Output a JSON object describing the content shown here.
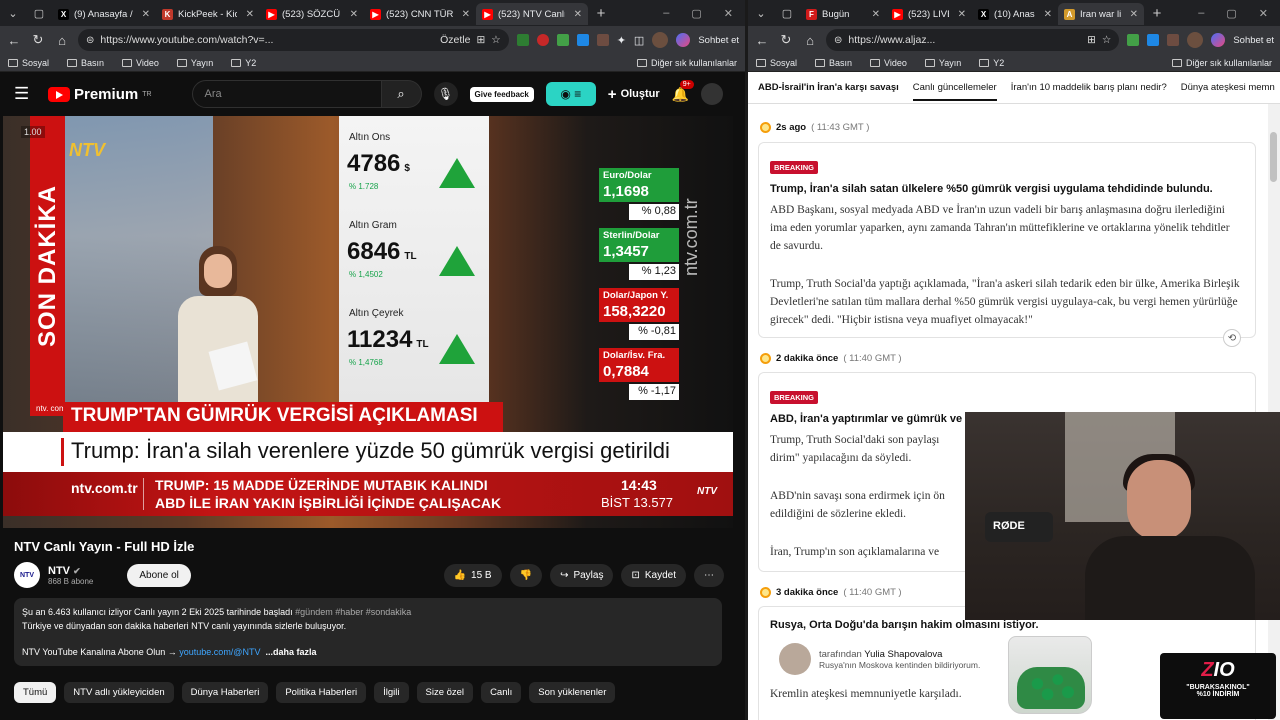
{
  "left_browser": {
    "tabs": [
      {
        "title": "(9) Anasayfa / X",
        "fav_color": "#000000",
        "fav_glyph": "X"
      },
      {
        "title": "KickPeek - Kick.com",
        "fav_color": "#53fc18",
        "fav_glyph": "K"
      },
      {
        "title": "(523) SÖZCÜ TV Can",
        "fav_color": "#ff0000",
        "fav_glyph": "▶"
      },
      {
        "title": "(523) CNN TÜRK",
        "fav_color": "#ff0000",
        "fav_glyph": "▶"
      },
      {
        "title": "(523) NTV Canlı",
        "fav_color": "#ff0000",
        "fav_glyph": "▶"
      }
    ],
    "url": "https://www.youtube.com/watch?v=...",
    "ozetle": "Özetle",
    "bookmarks": [
      "Sosyal",
      "Basın",
      "Video",
      "Yayın",
      "Y2"
    ],
    "bookmark_other": "Diğer sık kullanılanlar",
    "chat_label": "Sohbet et"
  },
  "youtube": {
    "brand": "Premium",
    "brand_sup": "TR",
    "search_placeholder": "Ara",
    "feedback": "Give feedback",
    "create": "Oluştur",
    "notif_count": "9+",
    "video_title": "NTV Canlı Yayın - Full HD İzle",
    "channel_name": "NTV",
    "channel_subs": "868 B abone",
    "subscribe": "Abone ol",
    "likes": "15 B",
    "share": "Paylaş",
    "save": "Kaydet",
    "desc_line1_a": "Şu an 6.463 kullanıcı izliyor  Canlı yayın 2 Eki 2025 tarihinde başladı  ",
    "desc_line1_tags": "#gündem #haber #sondakika",
    "desc_line2": "Türkiye ve dünyadan son dakika haberleri NTV canlı yayınında sizlerle buluşuyor.",
    "desc_line3_a": "NTV YouTube Kanalına Abone Olun → ",
    "desc_line3_link": "youtube.com/@NTV",
    "desc_more": "...daha fazla",
    "chips": [
      "Tümü",
      "NTV adlı yükleyiciden",
      "Dünya Haberleri",
      "Politika Haberleri",
      "İlgili",
      "Size özel",
      "Canlı",
      "Son yüklenenler"
    ]
  },
  "broadcast": {
    "speed": "1.00",
    "son_dakika": "SON DAKİKA",
    "ntv_logo": "NTV",
    "ntv_small": "ntv. com. tr",
    "gold": [
      {
        "name": "Altın Ons",
        "value": "4786",
        "unit": "$",
        "pct": "% 1.728"
      },
      {
        "name": "Altın Gram",
        "value": "6846",
        "unit": "TL",
        "pct": "% 1,4502"
      },
      {
        "name": "Altın Çeyrek",
        "value": "11234",
        "unit": "TL",
        "pct": "% 1,4768"
      }
    ],
    "fx": [
      {
        "name": "Euro/Dolar",
        "value": "1,1698",
        "pct": "% 0,88",
        "color": "#1f9d3a"
      },
      {
        "name": "Sterlin/Dolar",
        "value": "1,3457",
        "pct": "% 1,23",
        "color": "#1f9d3a"
      },
      {
        "name": "Dolar/Japon Y.",
        "value": "158,3220",
        "pct": "% -0,81",
        "color": "#cc1111"
      },
      {
        "name": "Dolar/İsv. Fra.",
        "value": "0,7884",
        "pct": "% -1,17",
        "color": "#cc1111"
      }
    ],
    "vertical_site": "ntv.com.tr",
    "headline_red": "TRUMP'TAN GÜMRÜK VERGİSİ AÇIKLAMASI",
    "headline_white": "Trump: İran'a silah verenlere yüzde 50 gümrük vergisi getirildi",
    "ticker_site": "ntv.com.tr",
    "ticker_line1": "TRUMP: 15 MADDE ÜZERİNDE MUTABIK KALINDI",
    "ticker_line2": "ABD İLE İRAN YAKIN İŞBİRLİĞİ İÇİNDE ÇALIŞACAK",
    "time": "14:43",
    "bist": "BİST  13.577",
    "ticker_ntv": "NTV"
  },
  "right_browser": {
    "tabs": [
      {
        "title": "Bugün",
        "fav_color": "#d11a1a",
        "fav_glyph": "F"
      },
      {
        "title": "(523) LIVE: V",
        "fav_color": "#ff0000",
        "fav_glyph": "▶"
      },
      {
        "title": "(10) Anasayfa",
        "fav_color": "#000000",
        "fav_glyph": "X"
      },
      {
        "title": "Iran war live",
        "fav_color": "#d29a2b",
        "fav_glyph": "A"
      }
    ],
    "url": "https://www.aljaz...",
    "chat_label": "Sohbet et",
    "bookmarks": [
      "Sosyal",
      "Basın",
      "Video",
      "Yayın",
      "Y2"
    ],
    "bookmark_other": "Diğer sık kullanılanlar"
  },
  "aljazeera": {
    "subnav": [
      "ABD-İsrail'in İran'a karşı savaşı",
      "Canlı güncellemeler",
      "İran'ın 10 maddelik barış planı nedir?",
      "Dünya ateşkesi memn"
    ],
    "updates": [
      {
        "ago": "2s ago",
        "gmt": "( 11:43 GMT )",
        "badge": "BREAKING",
        "headline": "Trump, İran'a silah satan ülkelere %50 gümrük vergisi uygulama tehdidinde bulundu.",
        "p1": "ABD Başkanı, sosyal medyada ABD ve İran'ın uzun vadeli bir barış anlaşmasına doğru ilerlediğini ima eden yorumlar yaparken, aynı zamanda Tahran'ın müttefiklerine ve ortaklarına yönelik tehditler de savurdu.",
        "p2": "Trump, Truth Social'da yaptığı açıklamada, \"İran'a askeri silah tedarik eden bir ülke, Amerika Birleşik Devletleri'ne satılan tüm mallara derhal %50 gümrük vergisi uygulaya-cak, bu vergi hemen yürürlüğe girecek\" dedi. \"Hiçbir istisna veya muafiyet olmayacak!\""
      },
      {
        "ago": "2 dakika önce",
        "gmt": "( 11:40 GMT )",
        "badge": "BREAKING",
        "headline": "ABD, İran'a yaptırımlar ve gümrük ve",
        "p1": "Trump, Truth Social'daki son paylaşı\ndirim\" yapılacağını da söyledi.",
        "p2": "ABD'nin savaşı sona erdirmek için ön\nedildiğini de sözlerine ekledi.",
        "p3": "İran, Trump'ın son açıklamalarına ve"
      },
      {
        "ago": "3 dakika önce",
        "gmt": "( 11:40 GMT )",
        "headline": "Rusya, Orta Doğu'da barışın hakim olmasını istiyor.",
        "by_label": "tarafından",
        "author": "Yulia Shapovalova",
        "location": "Rusya'nın Moskova kentinden bildiriyorum.",
        "p1": "Kremlin ateşkesi memnuniyetle karşıladı."
      }
    ]
  },
  "overlay": {
    "mic_brand": "RØDE",
    "promo_logo_a": "Z",
    "promo_logo_b": "IO",
    "promo_code": "\"BURAKSAKINOL\"",
    "promo_discount": "%10 İNDİRİM"
  }
}
